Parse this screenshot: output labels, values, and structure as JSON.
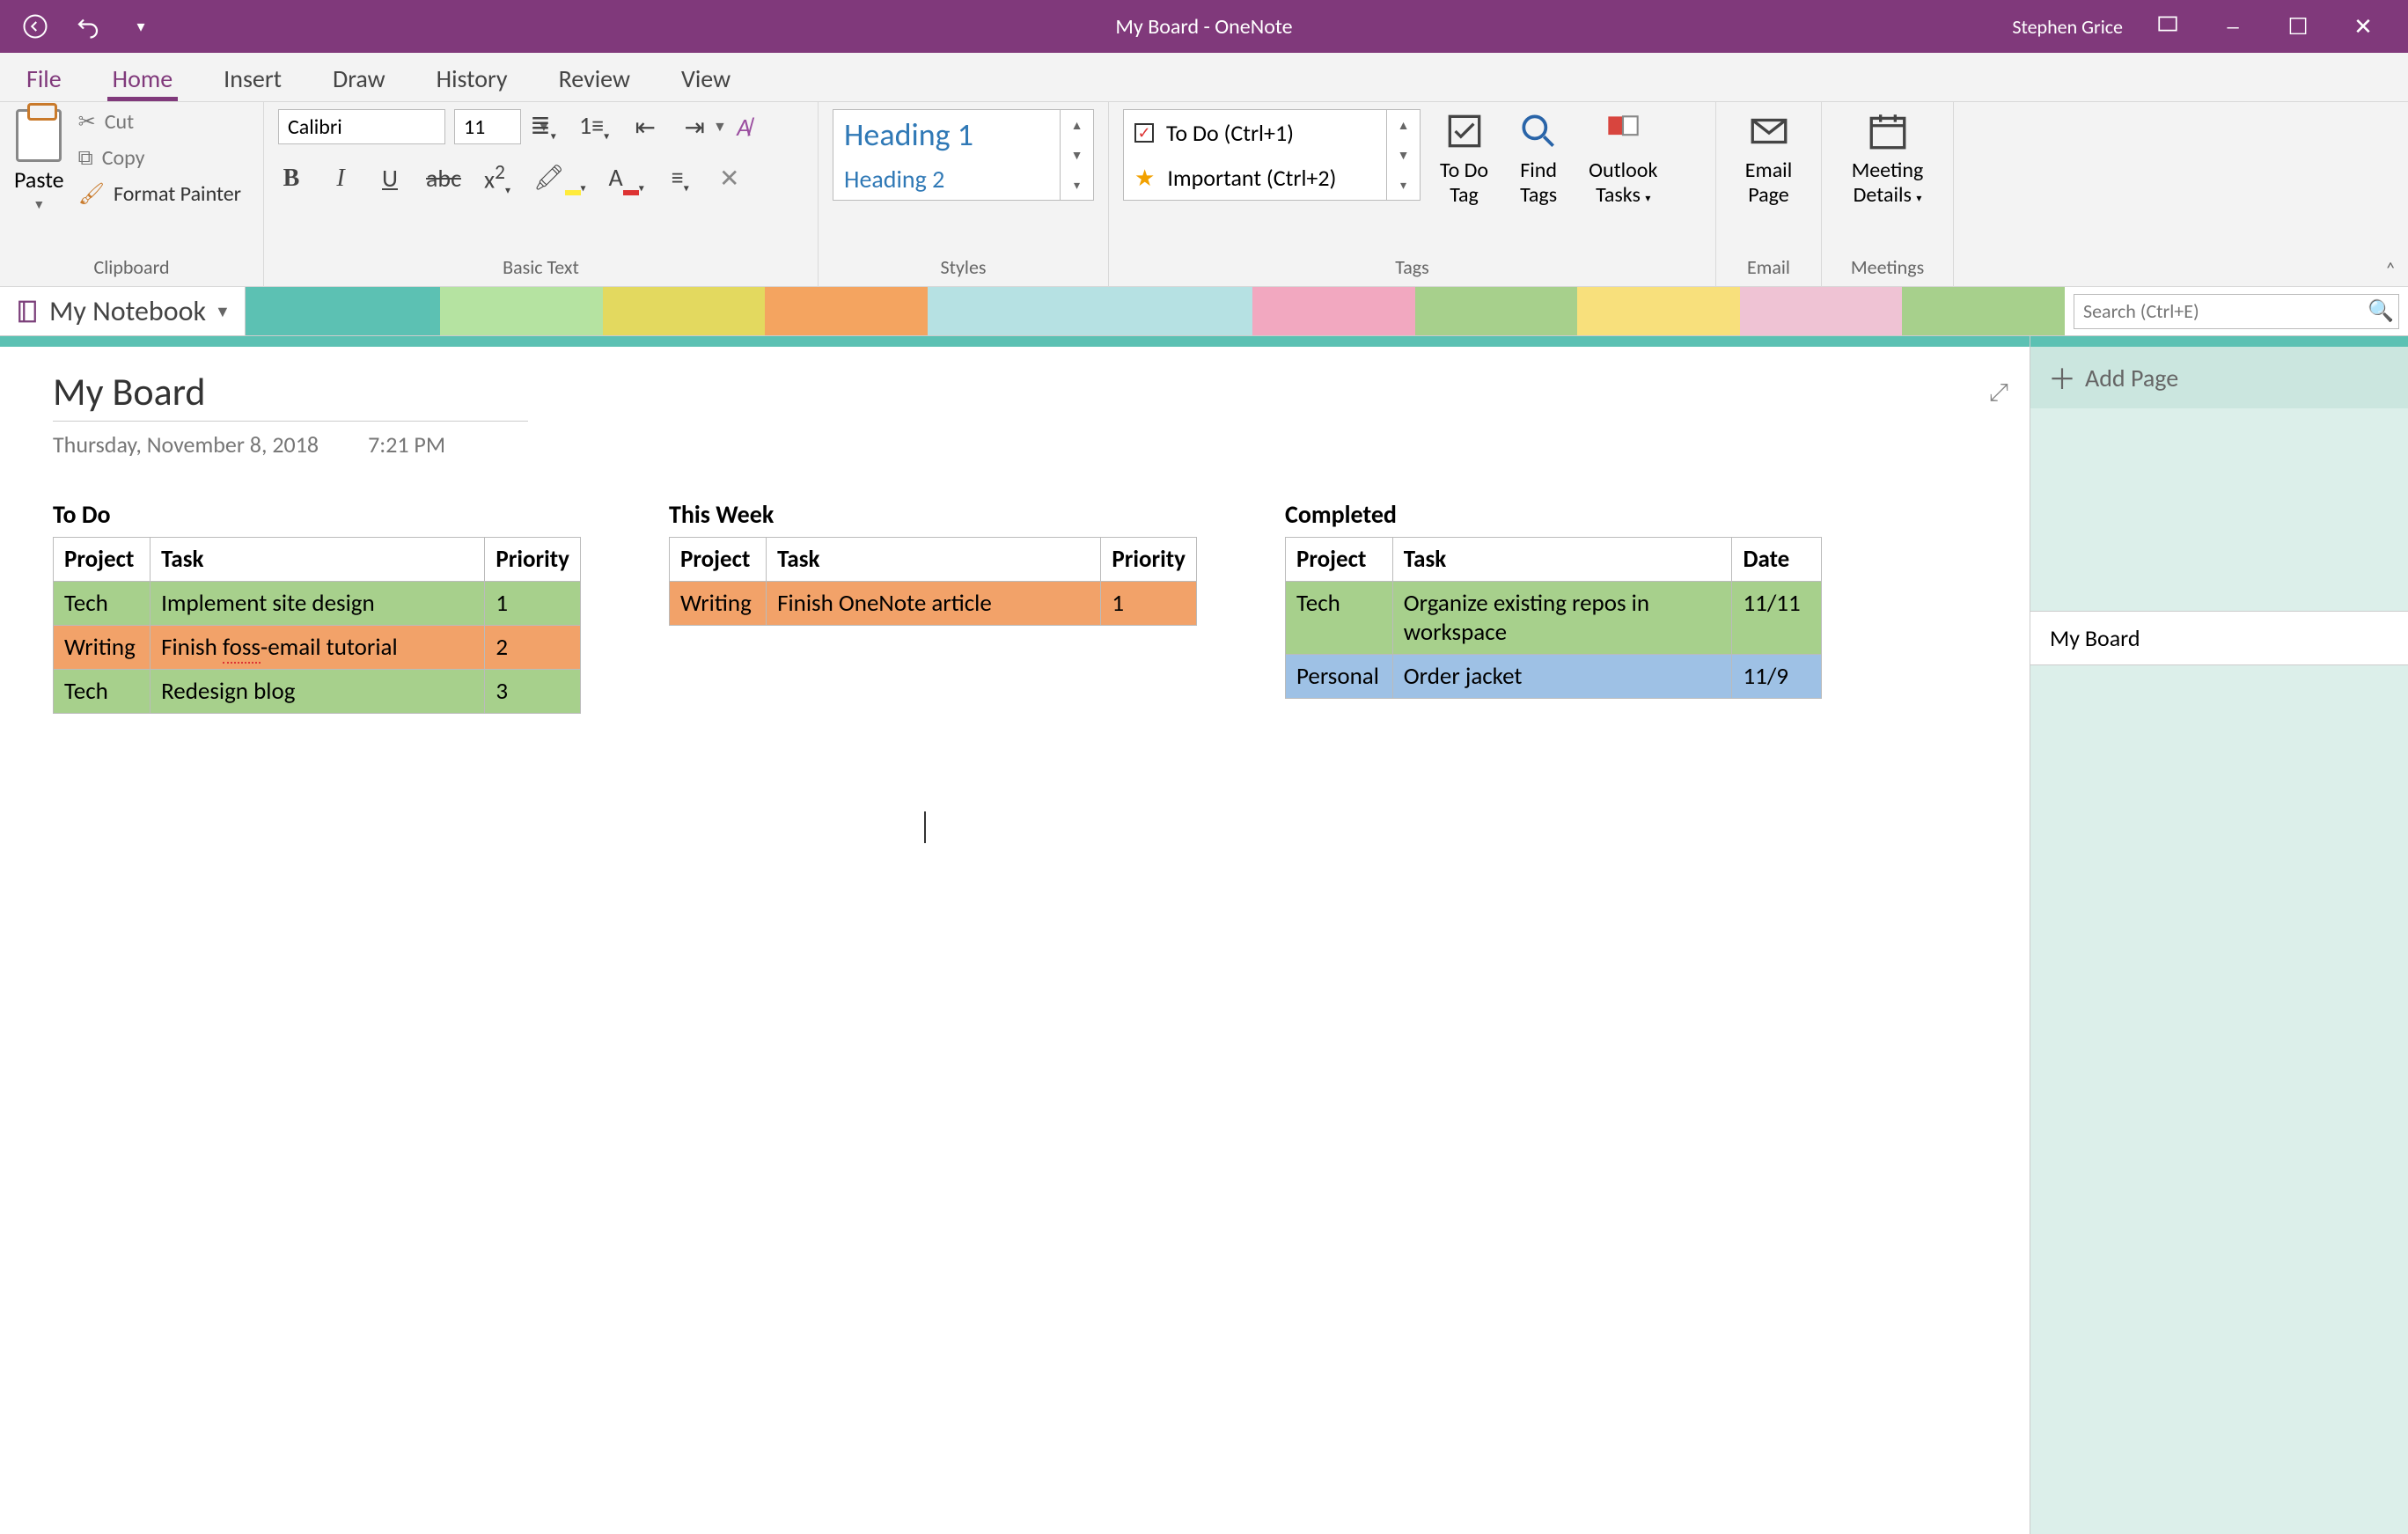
{
  "title_bar": {
    "document": "My Board",
    "app": "OneNote",
    "full": "My Board  -  OneNote",
    "user": "Stephen Grice"
  },
  "ribbon_tabs": [
    "File",
    "Home",
    "Insert",
    "Draw",
    "History",
    "Review",
    "View"
  ],
  "active_tab": "Home",
  "clipboard": {
    "paste": "Paste",
    "cut": "Cut",
    "copy": "Copy",
    "format_painter": "Format Painter",
    "group": "Clipboard"
  },
  "basic_text": {
    "font": "Calibri",
    "size": "11",
    "group": "Basic Text"
  },
  "styles": {
    "h1": "Heading 1",
    "h2": "Heading 2",
    "group": "Styles"
  },
  "tags": {
    "todo": "To Do (Ctrl+1)",
    "important": "Important (Ctrl+2)",
    "todo_tag": "To Do\nTag",
    "find_tags": "Find\nTags",
    "outlook": "Outlook\nTasks",
    "group": "Tags"
  },
  "email": {
    "label": "Email\nPage",
    "group": "Email"
  },
  "meetings": {
    "label": "Meeting\nDetails",
    "group": "Meetings"
  },
  "notebook": "My Notebook",
  "search_placeholder": "Search (Ctrl+E)",
  "add_page": "Add Page",
  "pages": [
    "My Board"
  ],
  "page": {
    "title": "My Board",
    "date": "Thursday, November 8, 2018",
    "time": "7:21 PM"
  },
  "section_colors": [
    "#5CC1B3",
    "#B5E3A1",
    "#E3D95F",
    "#F4A460",
    "#B6E1E3",
    "#B6E1E3",
    "#F2A8C0",
    "#A7D08C",
    "#F8E07C",
    "#EFC3D4",
    "#A7D08C"
  ],
  "board_todo": {
    "heading": "To Do",
    "cols": [
      "Project",
      "Task",
      "Priority"
    ],
    "rows": [
      {
        "cls": "row-green",
        "cells": [
          "Tech",
          "Implement site design",
          "1"
        ]
      },
      {
        "cls": "row-orange",
        "cells": [
          "Writing",
          "Finish foss-email tutorial",
          "2"
        ],
        "spell": "foss"
      },
      {
        "cls": "row-green",
        "cells": [
          "Tech",
          "Redesign blog",
          "3"
        ]
      }
    ]
  },
  "board_week": {
    "heading": "This Week",
    "cols": [
      "Project",
      "Task",
      "Priority"
    ],
    "rows": [
      {
        "cls": "row-orange",
        "cells": [
          "Writing",
          "Finish OneNote article",
          "1"
        ]
      }
    ]
  },
  "board_done": {
    "heading": "Completed",
    "cols": [
      "Project",
      "Task",
      "Date"
    ],
    "rows": [
      {
        "cls": "row-green",
        "cells": [
          "Tech",
          "Organize existing repos in workspace",
          "11/11"
        ]
      },
      {
        "cls": "row-blue",
        "cells": [
          "Personal",
          "Order jacket",
          "11/9"
        ]
      }
    ]
  }
}
